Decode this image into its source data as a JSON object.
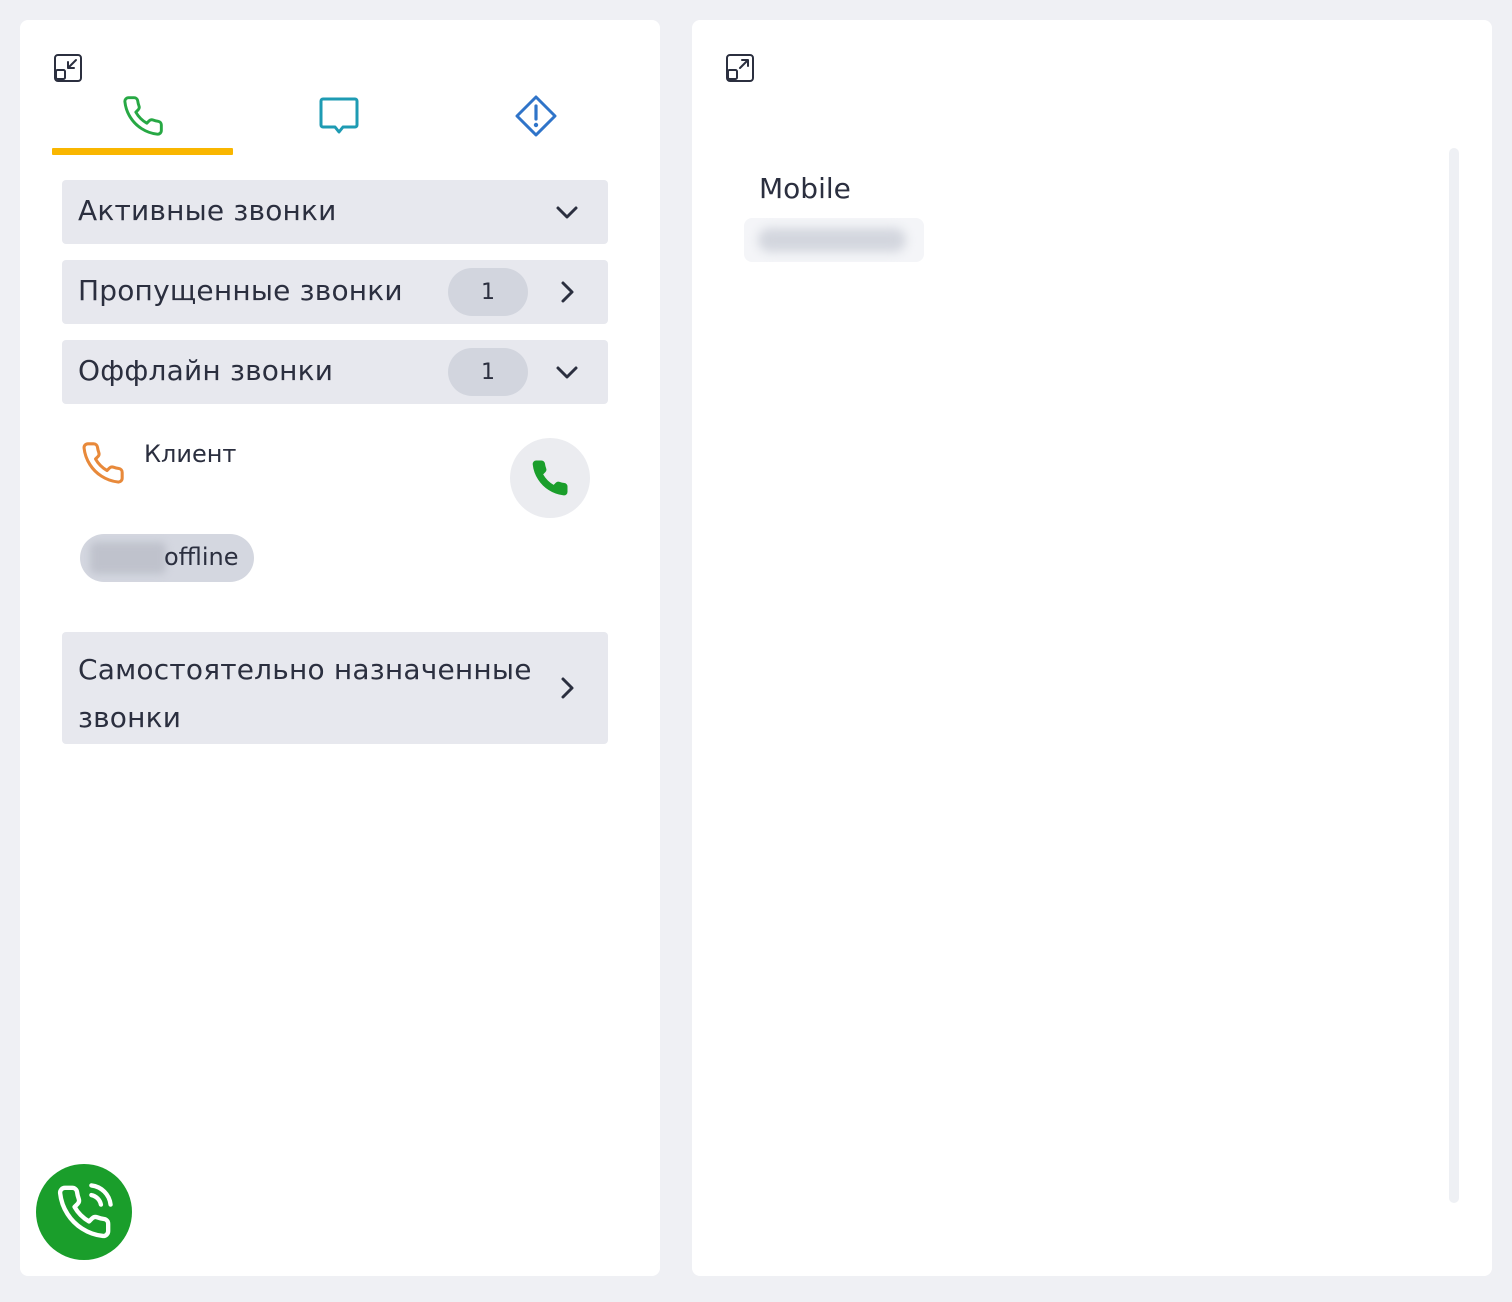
{
  "colors": {
    "background": "#eff0f4",
    "panel": "#ffffff",
    "section_bg": "#e7e8ee",
    "badge_bg": "#d2d5de",
    "tab_underline": "#f9b600",
    "phone_tab_green": "#27a844",
    "chat_tab_teal": "#1e9bb3",
    "alert_tab_blue": "#2f74c9",
    "offline_call_orange": "#e8893a",
    "fab_green": "#1a9e2b"
  },
  "left_panel": {
    "collapse_icon": "collapse-icon",
    "tabs": [
      {
        "icon": "phone-icon",
        "active": true
      },
      {
        "icon": "chat-icon",
        "active": false
      },
      {
        "icon": "alert-diamond-icon",
        "active": false
      }
    ],
    "sections": {
      "active_calls": {
        "title": "Активные звонки",
        "expanded": true
      },
      "missed_calls": {
        "title": "Пропущенные звонки",
        "count": "1",
        "expanded": false
      },
      "offline_calls": {
        "title": "Оффлайн звонки",
        "count": "1",
        "expanded": true
      },
      "self_assigned_calls": {
        "title": "Самостоятельно назначенные звонки",
        "expanded": false
      }
    },
    "offline_call_item": {
      "name": "Клиент",
      "status": "offline"
    },
    "fab_icon": "phone-ringing-icon"
  },
  "right_panel": {
    "expand_icon": "expand-icon",
    "field_label": "Mobile"
  }
}
